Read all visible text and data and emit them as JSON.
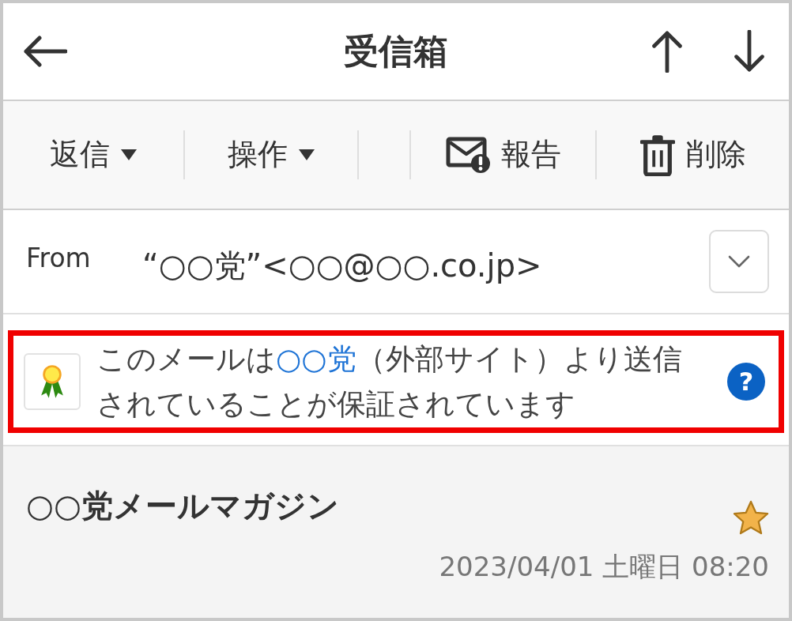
{
  "header": {
    "title": "受信箱"
  },
  "toolbar": {
    "left": [
      {
        "kind": "dropdown",
        "label": "返信"
      },
      {
        "kind": "dropdown",
        "label": "操作"
      }
    ],
    "right": [
      {
        "kind": "report",
        "label": "報告"
      },
      {
        "kind": "delete",
        "label": "削除"
      }
    ]
  },
  "from": {
    "label": "From",
    "address": "“○○党”<○○@○○.co.jp>",
    "expanded": false
  },
  "notice": {
    "highlighted": true,
    "before": "このメールは",
    "link": "○○党",
    "after": "（外部サイト）より送信されていることが保証されています",
    "help": "?"
  },
  "message": {
    "subject": "○○党メールマガジン",
    "starred": true,
    "date": "2023/04/01 土曜日 08:20"
  }
}
